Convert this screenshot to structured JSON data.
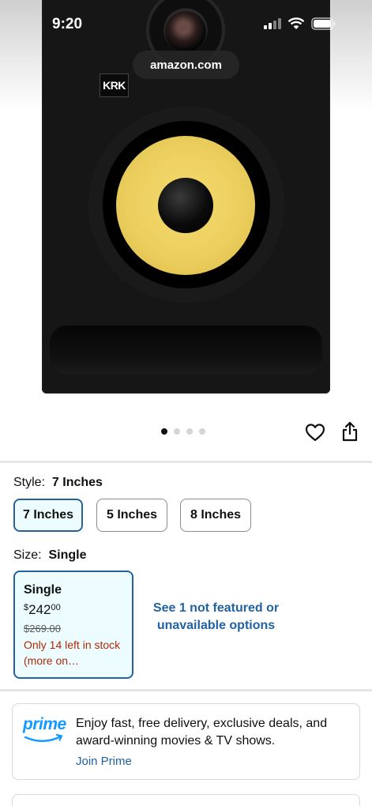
{
  "status_bar": {
    "time": "9:20"
  },
  "browser": {
    "url": "amazon.com"
  },
  "product_image": {
    "brand_logo": "KRK",
    "image_count": 4,
    "active_index": 0
  },
  "actions": {
    "wishlist_icon": "heart-icon",
    "share_icon": "share-icon"
  },
  "style": {
    "label": "Style:",
    "selected": "7 Inches",
    "options": [
      "7 Inches",
      "5 Inches",
      "8 Inches"
    ]
  },
  "size": {
    "label": "Size:",
    "selected": "Single",
    "card": {
      "title": "Single",
      "price_symbol": "$",
      "price_whole": "242",
      "price_fraction": "00",
      "list_price": "$269.00",
      "stock_note": "Only 14 left in stock (more on…"
    },
    "unavailable_link": "See 1 not featured or unavailable options"
  },
  "prime": {
    "logo_text": "prime",
    "message": "Enjoy fast, free delivery, exclusive deals, and award-winning movies & TV shows.",
    "cta": "Join Prime"
  },
  "colors": {
    "link_blue": "#2162a1",
    "selected_bg": "#edfdff",
    "deal_red": "#b12704",
    "prime_blue": "#1399ff",
    "woofer_yellow": "#eccf5e"
  }
}
